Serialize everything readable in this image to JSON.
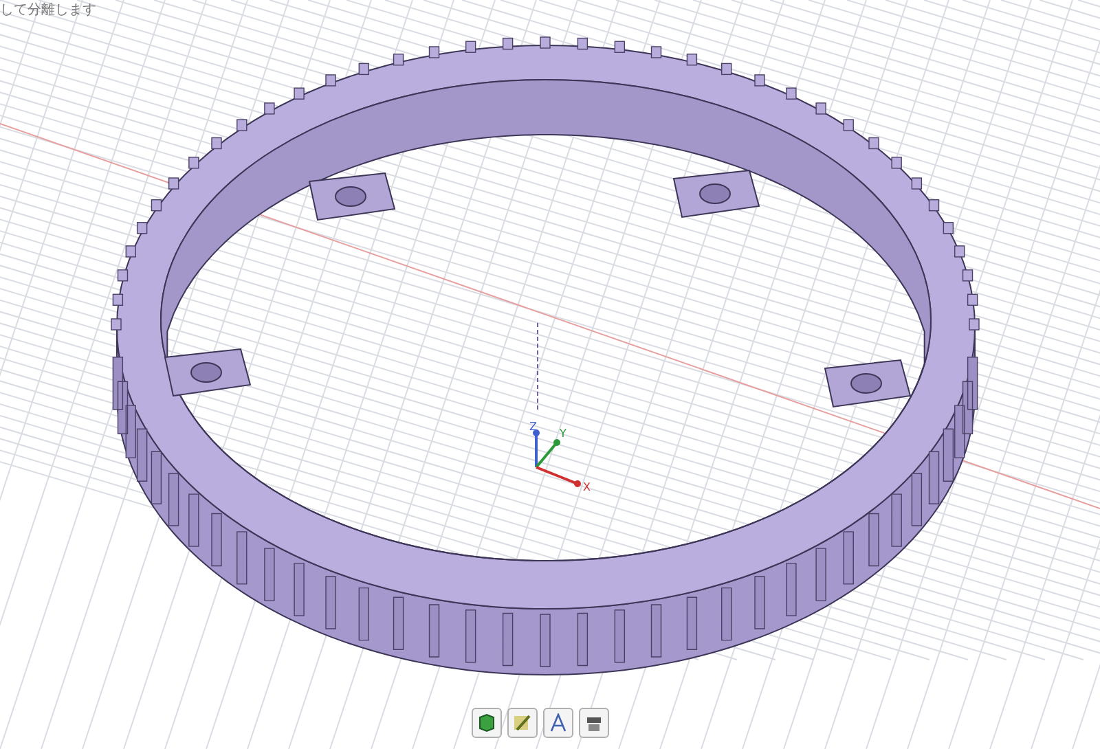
{
  "hint_text": "して分離します",
  "axes": [
    {
      "label": "Z",
      "kind": "z"
    },
    {
      "label": "Y",
      "kind": "y"
    },
    {
      "label": "X",
      "kind": "x"
    }
  ],
  "toolbar": {
    "buttons": [
      {
        "kind": "box"
      },
      {
        "kind": "sketch"
      },
      {
        "kind": "text"
      },
      {
        "kind": "render"
      }
    ]
  }
}
